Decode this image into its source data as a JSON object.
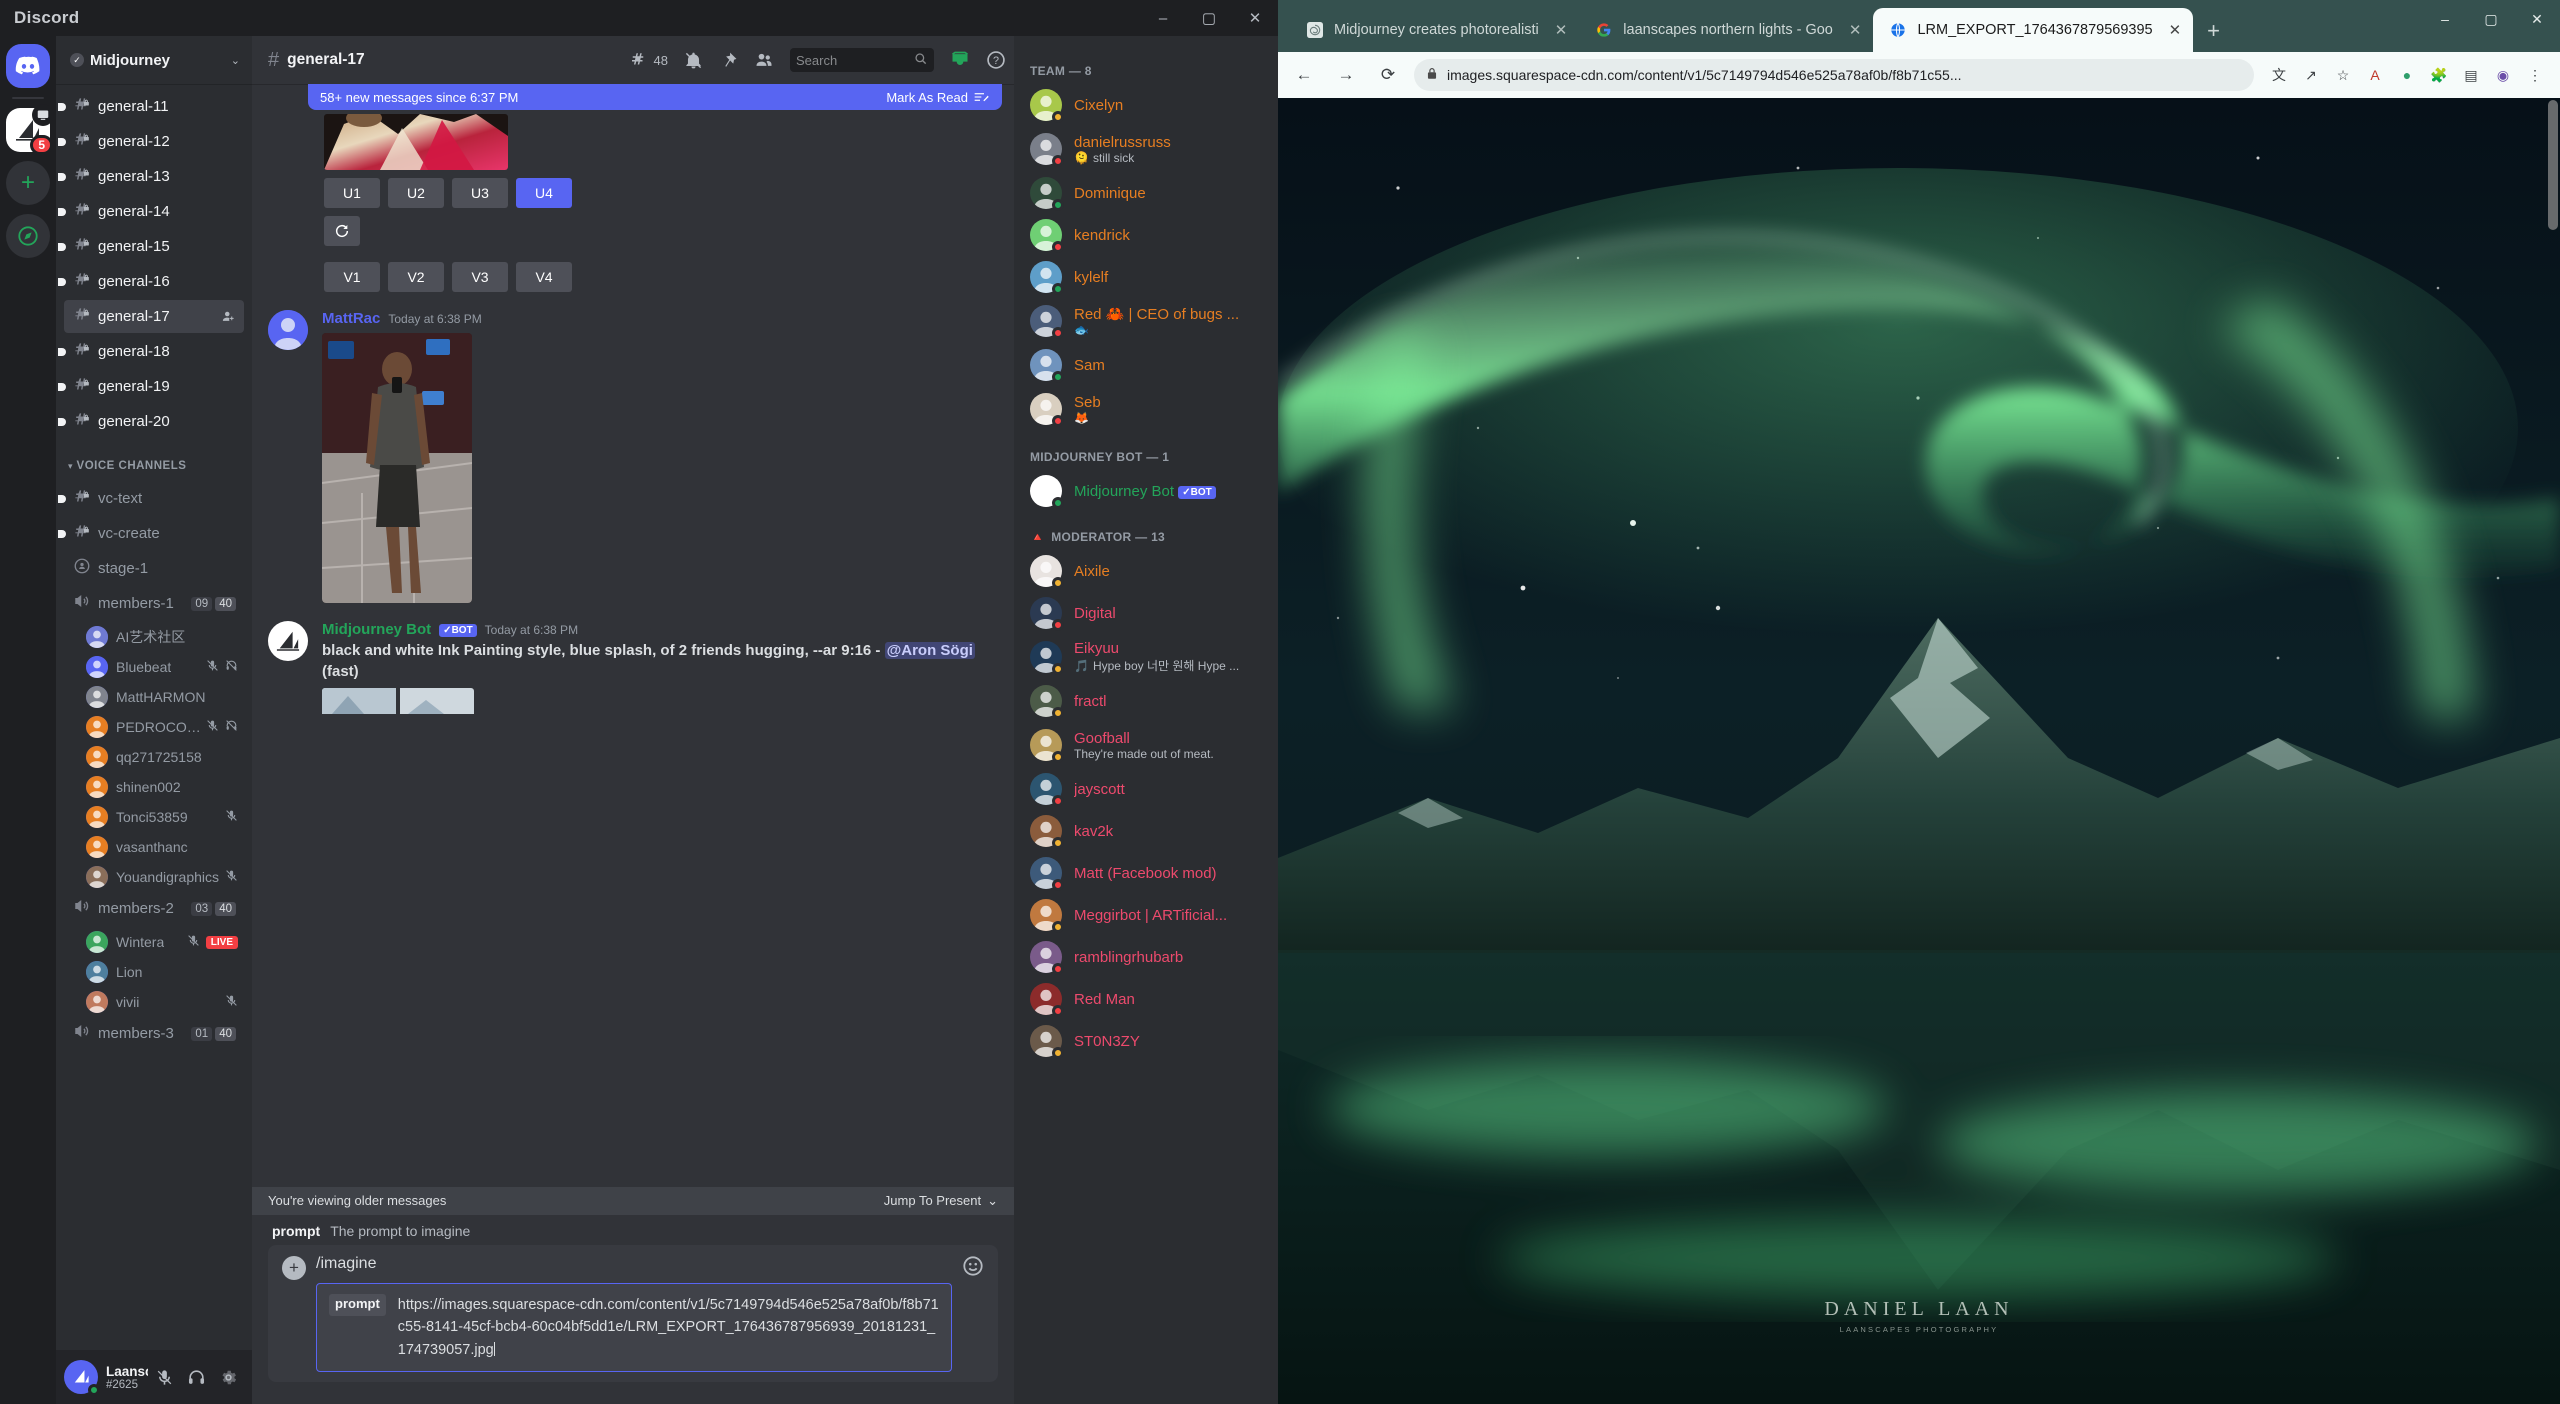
{
  "discord": {
    "window": {
      "brand": "Discord",
      "minimize": "–",
      "maximize": "▢",
      "close": "✕"
    },
    "guild_rail": {
      "home_label": "home-button",
      "active_server_badge": "5",
      "add_server": "+",
      "explore": "compass"
    },
    "server": {
      "name": "Midjourney",
      "verified": "✓"
    },
    "channels": [
      {
        "name": "general-11",
        "unread": true,
        "selected": false
      },
      {
        "name": "general-12",
        "unread": true,
        "selected": false
      },
      {
        "name": "general-13",
        "unread": true,
        "selected": false
      },
      {
        "name": "general-14",
        "unread": true,
        "selected": false
      },
      {
        "name": "general-15",
        "unread": true,
        "selected": false
      },
      {
        "name": "general-16",
        "unread": true,
        "selected": false
      },
      {
        "name": "general-17",
        "unread": false,
        "selected": true
      },
      {
        "name": "general-18",
        "unread": true,
        "selected": false
      },
      {
        "name": "general-19",
        "unread": true,
        "selected": false
      },
      {
        "name": "general-20",
        "unread": true,
        "selected": false
      }
    ],
    "voice_category": "VOICE CHANNELS",
    "voice_channels": [
      {
        "name": "vc-text",
        "type": "text",
        "unread": true
      },
      {
        "name": "vc-create",
        "type": "text",
        "unread": true
      },
      {
        "name": "stage-1",
        "type": "stage"
      },
      {
        "name": "members-1",
        "type": "voice",
        "count_left": "09",
        "count_right": "40",
        "members": [
          {
            "name": "AI艺术社区",
            "muted": false,
            "deafened": false,
            "color": "#6f7ad3"
          },
          {
            "name": "Bluebeat",
            "muted": true,
            "deafened": true,
            "color": "#5865f2"
          },
          {
            "name": "MattHARMON",
            "muted": false,
            "deafened": false,
            "color": "#80848e"
          },
          {
            "name": "PEDROCOELHO...",
            "muted": true,
            "deafened": true,
            "color": "#e67e22"
          },
          {
            "name": "qq271725158",
            "muted": false,
            "deafened": false,
            "color": "#e67e22"
          },
          {
            "name": "shinen002",
            "muted": false,
            "deafened": false,
            "color": "#e67e22"
          },
          {
            "name": "Tonci53859",
            "muted": true,
            "deafened": false,
            "color": "#e67e22"
          },
          {
            "name": "vasanthanc",
            "muted": false,
            "deafened": false,
            "color": "#e67e22"
          },
          {
            "name": "Youandigraphics",
            "muted": true,
            "deafened": false,
            "color": "#8a6e5a"
          }
        ]
      },
      {
        "name": "members-2",
        "type": "voice",
        "count_left": "03",
        "count_right": "40",
        "members": [
          {
            "name": "Wintera",
            "muted": true,
            "deafened": false,
            "live": "LIVE",
            "color": "#3ba55d"
          },
          {
            "name": "Lion",
            "muted": false,
            "deafened": false,
            "color": "#4e7f9e"
          },
          {
            "name": "vivii",
            "muted": true,
            "deafened": false,
            "color": "#c07a5e"
          }
        ]
      },
      {
        "name": "members-3",
        "type": "voice",
        "count_left": "01",
        "count_right": "40",
        "members": []
      }
    ],
    "user_panel": {
      "name": "Laanscapes",
      "tag": "#2625",
      "mic": "mic-icon",
      "headset": "headset-icon",
      "settings": "gear-icon"
    },
    "chat_header": {
      "channel": "general-17",
      "threads_count": "48",
      "notification_icon": "bell-off-icon",
      "pin_icon": "pin-icon",
      "members_icon": "members-icon",
      "search_placeholder": "Search",
      "inbox_icon": "inbox-icon",
      "help_icon": "help-icon"
    },
    "new_messages_banner": {
      "text": "58+ new messages since 6:37 PM",
      "mark_as_read": "Mark As Read"
    },
    "upscale_buttons": [
      "U1",
      "U2",
      "U3",
      "U4"
    ],
    "reroll_button": "🔄",
    "variation_buttons": [
      "V1",
      "V2",
      "V3",
      "V4"
    ],
    "selected_button": "U4",
    "messages": [
      {
        "author": "MattRac",
        "author_color": "#5865f2",
        "timestamp": "Today at 6:38 PM",
        "is_bot": false,
        "attachment": "photo"
      },
      {
        "author": "Midjourney Bot",
        "author_color": "#23a55a",
        "bot_tag": "BOT",
        "bot_check": "✓",
        "timestamp": "Today at 6:38 PM",
        "is_bot": true,
        "text_part1": "black and white Ink Painting style, blue splash, of 2 friends hugging, --ar 9:16 - ",
        "mention": "@Aron Sögi",
        "text_part2": " (fast)"
      }
    ],
    "jump_bar": {
      "text": "You're viewing older messages",
      "action": "Jump To Present"
    },
    "composer": {
      "prompt_label": "prompt",
      "prompt_description": "The prompt to imagine",
      "command": "/imagine",
      "arg_label": "prompt",
      "arg_value": "https://images.squarespace-cdn.com/content/v1/5c7149794d546e525a78af0b/f8b71c55-8141-45cf-bcb4-60c04bf5dd1e/LRM_EXPORT_176436787956939_20181231_174739057.jpg",
      "add_icon": "+",
      "emoji_icon": "emoji-icon"
    },
    "member_list": {
      "groups": [
        {
          "label": "TEAM — 8",
          "members": [
            {
              "name": "Cixelyn",
              "color": "#e67e22",
              "status": "idle",
              "avatar": "#a8c84a"
            },
            {
              "name": "danielrussruss",
              "color": "#e67e22",
              "status": "dnd",
              "activity": "still sick",
              "activity_emoji": "🫠",
              "avatar": "#7a7f8a"
            },
            {
              "name": "Dominique",
              "color": "#e67e22",
              "status": "online",
              "avatar": "#2f4a3a"
            },
            {
              "name": "kendrick",
              "color": "#e67e22",
              "status": "dnd",
              "avatar": "#6fcf74"
            },
            {
              "name": "kylelf",
              "color": "#e67e22",
              "status": "online",
              "avatar": "#5e9ec9"
            },
            {
              "name": "Red 🦀 | CEO of bugs ...",
              "color": "#e67e22",
              "status": "dnd",
              "activity": "🐟",
              "avatar": "#4b5d7a"
            },
            {
              "name": "Sam",
              "color": "#e67e22",
              "status": "online",
              "avatar": "#6f93bd"
            },
            {
              "name": "Seb",
              "color": "#e67e22",
              "status": "dnd",
              "activity": "🦊",
              "avatar": "#d9cfc0"
            }
          ]
        },
        {
          "label": "MIDJOURNEY BOT — 1",
          "members": [
            {
              "name": "Midjourney Bot",
              "color": "#23a55a",
              "status": "online",
              "bot_tag": "BOT",
              "bot_check": "✓",
              "avatar": "#ffffff"
            }
          ]
        },
        {
          "label": "MODERATOR — 13",
          "icon": "🔺",
          "members": [
            {
              "name": "Aixile",
              "color": "#e67e22",
              "status": "idle",
              "avatar": "#e8e3e0"
            },
            {
              "name": "Digital",
              "color": "#ed4a6d",
              "status": "dnd",
              "avatar": "#2b3a52"
            },
            {
              "name": "Eikyuu",
              "color": "#ed4a6d",
              "status": "idle",
              "activity": "Hype boy 너만 원해 Hype ...",
              "activity_emoji": "🎵",
              "avatar": "#1f3a56"
            },
            {
              "name": "fractl",
              "color": "#ed4a6d",
              "status": "idle",
              "avatar": "#4c5b48"
            },
            {
              "name": "Goofball",
              "color": "#ed4a6d",
              "status": "idle",
              "activity": "They're made out of meat.",
              "avatar": "#b79a58"
            },
            {
              "name": "jayscott",
              "color": "#ed4a6d",
              "status": "dnd",
              "avatar": "#2c5570"
            },
            {
              "name": "kav2k",
              "color": "#ed4a6d",
              "status": "idle",
              "avatar": "#8b5c3c"
            },
            {
              "name": "Matt (Facebook mod)",
              "color": "#ed4a6d",
              "status": "dnd",
              "avatar": "#3d5a7a"
            },
            {
              "name": "Meggirbot | ARTificial...",
              "color": "#ed4a6d",
              "status": "idle",
              "avatar": "#c0793f"
            },
            {
              "name": "ramblingrhubarb",
              "color": "#ed4a6d",
              "status": "dnd",
              "avatar": "#7a5b8a"
            },
            {
              "name": "Red Man",
              "color": "#ed4a6d",
              "status": "dnd",
              "avatar": "#8c2b2b"
            },
            {
              "name": "ST0N3ZY",
              "color": "#ed4a6d",
              "status": "idle",
              "avatar": "#6b5a4a"
            }
          ]
        }
      ]
    }
  },
  "browser": {
    "tabs": [
      {
        "title": "Midjourney creates photorealisti",
        "favicon": "spiral",
        "active": false,
        "close": "✕"
      },
      {
        "title": "laanscapes northern lights - Goo",
        "favicon": "google",
        "active": false,
        "close": "✕"
      },
      {
        "title": "LRM_EXPORT_1764367879569395",
        "favicon": "globe",
        "active": true,
        "close": "✕"
      }
    ],
    "new_tab": "+",
    "window_controls": {
      "minimize": "–",
      "maximize": "▢",
      "close": "✕"
    },
    "nav": {
      "back": "←",
      "forward": "→",
      "reload": "⟳"
    },
    "url": "images.squarespace-cdn.com/content/v1/5c7149794d546e525a78af0b/f8b71c55...",
    "lock_icon": "lock-icon",
    "toolbar_icons": [
      "translate-icon",
      "share-icon",
      "bookmark-icon",
      "profile-a-icon",
      "circle-icon",
      "puzzle-icon",
      "sidebar-icon",
      "account-icon",
      "menu-icon"
    ],
    "image": {
      "watermark_line1": "DANIEL  LAAN",
      "watermark_line2": "LAANSCAPES PHOTOGRAPHY"
    }
  }
}
